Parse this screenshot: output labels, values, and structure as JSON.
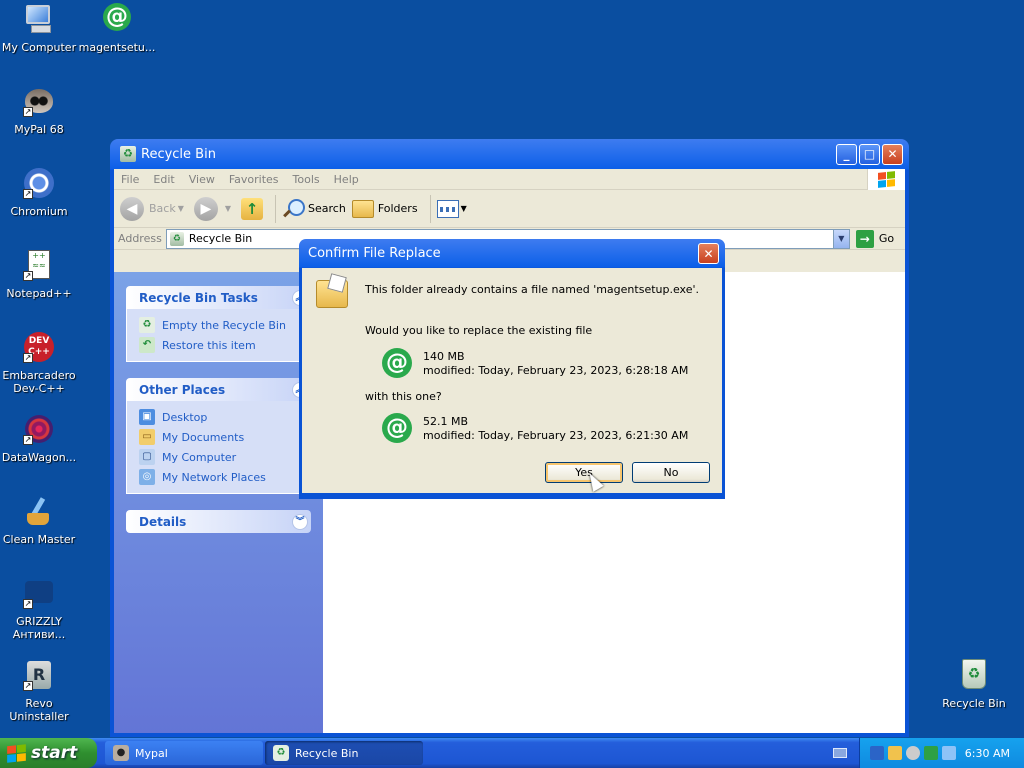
{
  "desktop": {
    "icons": [
      {
        "label": "My Computer"
      },
      {
        "label": "magentsetu..."
      },
      {
        "label": "MyPal 68"
      },
      {
        "label": "Chromium"
      },
      {
        "label": "Notepad++"
      },
      {
        "label": "Embarcadero Dev-C++"
      },
      {
        "label": "DataWagon..."
      },
      {
        "label": "Clean Master"
      },
      {
        "label": "GRIZZLY Антиви..."
      },
      {
        "label": "Revo Uninstaller"
      },
      {
        "label": "Recycle Bin"
      }
    ]
  },
  "window": {
    "title": "Recycle Bin",
    "menu": [
      "File",
      "Edit",
      "View",
      "Favorites",
      "Tools",
      "Help"
    ],
    "toolbar": {
      "back": "Back",
      "search": "Search",
      "folders": "Folders"
    },
    "address": {
      "label": "Address",
      "value": "Recycle Bin",
      "go": "Go"
    },
    "tasks": {
      "recycle_title": "Recycle Bin Tasks",
      "recycle_items": [
        "Empty the Recycle Bin",
        "Restore this item"
      ],
      "places_title": "Other Places",
      "places_items": [
        "Desktop",
        "My Documents",
        "My Computer",
        "My Network Places"
      ],
      "details_title": "Details"
    }
  },
  "dialog": {
    "title": "Confirm File Replace",
    "message": "This folder already contains a file named 'magentsetup.exe'.",
    "question": "Would you like to replace the existing file",
    "existing": {
      "size": "140 MB",
      "modified": "modified: Today, February 23, 2023, 6:28:18 AM"
    },
    "with_text": "with this one?",
    "new_file": {
      "size": "52.1 MB",
      "modified": "modified: Today, February 23, 2023, 6:21:30 AM"
    },
    "yes": "Yes",
    "no": "No"
  },
  "taskbar": {
    "start": "start",
    "items": [
      "Mypal",
      "Recycle Bin"
    ],
    "clock": "6:30 AM"
  },
  "colors": {
    "desktop": "#0a4ea0",
    "title_blue": "#0c5fe8",
    "start_green": "#2f8f2f",
    "link_blue": "#215dc6"
  }
}
